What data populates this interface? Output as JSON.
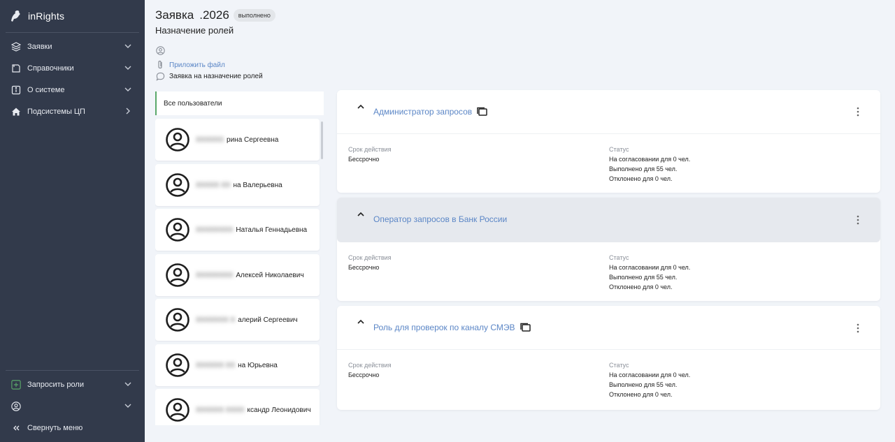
{
  "sidebar": {
    "brand": "inRights",
    "nav": [
      {
        "label": "Заявки",
        "icon": "layers-icon"
      },
      {
        "label": "Справочники",
        "icon": "book-icon"
      },
      {
        "label": "О системе",
        "icon": "info-icon"
      },
      {
        "label": "Подсистемы ЦП",
        "icon": "home-icon"
      }
    ],
    "bottom": {
      "request_roles": "Запросить роли",
      "user_name": "",
      "collapse": "Свернуть меню"
    }
  },
  "header": {
    "title_prefix": "Заявка",
    "title_hidden": "",
    "title_suffix": ".2026",
    "status": "выполнено",
    "subtitle": "Назначение ролей",
    "author": "",
    "attach": "Приложить файл",
    "comment": "Заявка на назначение ролей"
  },
  "users": {
    "tab_all": "Все пользователи",
    "items": [
      {
        "name": "рина Сергеевна"
      },
      {
        "name": "на Валерьевна"
      },
      {
        "name": "Наталья Геннадьевна"
      },
      {
        "name": "Алексей Николаевич"
      },
      {
        "name": "алерий Сергеевич"
      },
      {
        "name": "на Юрьевна"
      },
      {
        "name": "ксандр Леонидович"
      }
    ]
  },
  "roles": [
    {
      "title": "Администратор запросов",
      "term_label": "Срок действия",
      "term_value": "Бессрочно",
      "status_label": "Статус",
      "status_lines": [
        "На согласовании для 0 чел.",
        "Выполнено для 55 чел.",
        "Отклонено для 0 чел."
      ]
    },
    {
      "title": "Оператор запросов в Банк России",
      "term_label": "Срок действия",
      "term_value": "Бессрочно",
      "status_label": "Статус",
      "status_lines": [
        "На согласовании для 0 чел.",
        "Выполнено для 55 чел.",
        "Отклонено для 0 чел."
      ]
    },
    {
      "title": "Роль для проверок по каналу СМЭВ",
      "term_label": "Срок действия",
      "term_value": "Бессрочно",
      "status_label": "Статус",
      "status_lines": [
        "На согласовании для 0 чел.",
        "Выполнено для 55 чел.",
        "Отклонено для 0 чел."
      ]
    }
  ]
}
